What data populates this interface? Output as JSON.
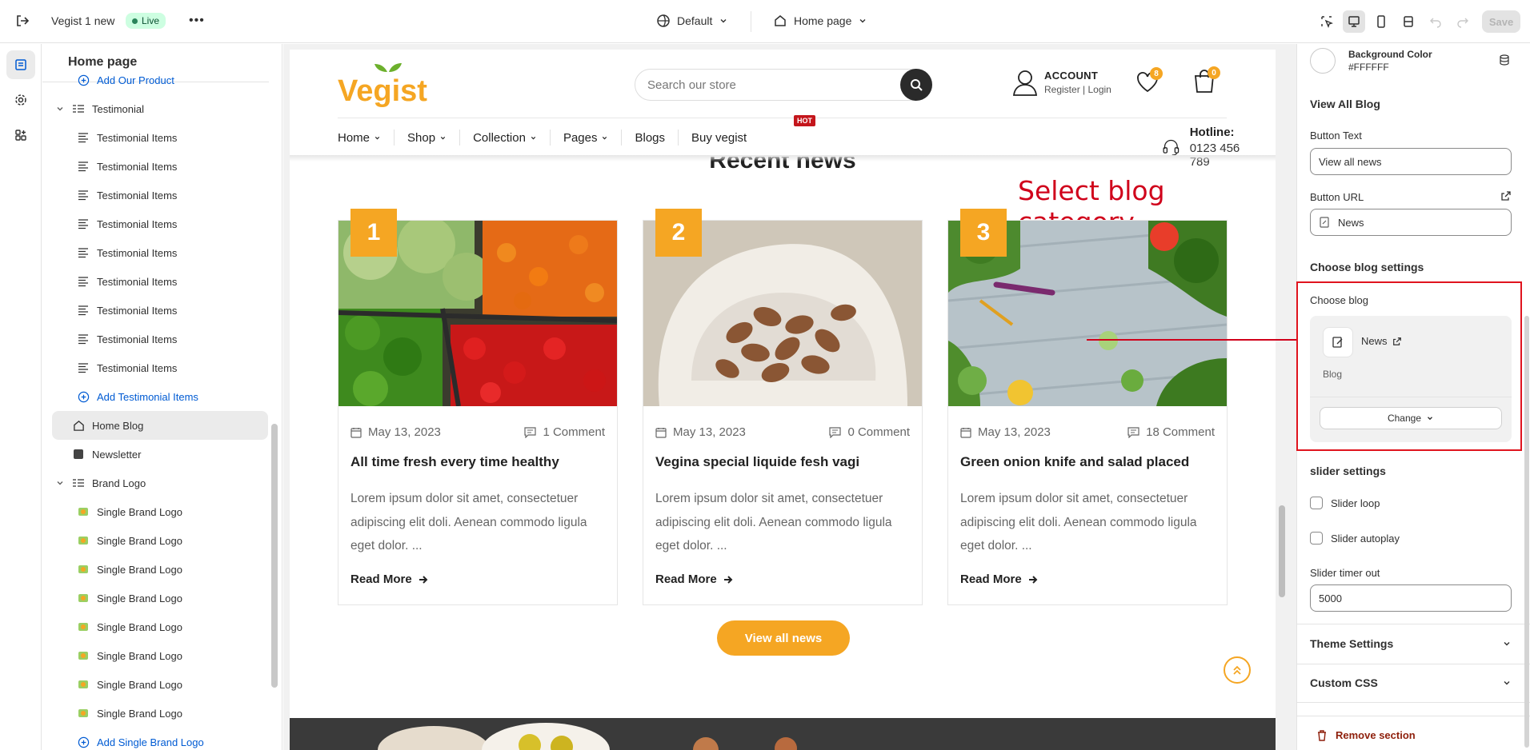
{
  "topbar": {
    "store_name": "Vegist 1 new",
    "status": "Live",
    "theme": "Default",
    "page": "Home page",
    "save": "Save"
  },
  "sidebar": {
    "title": "Home page",
    "items": [
      {
        "label": "Add Our Product",
        "kind": "add"
      },
      {
        "label": "Testimonial",
        "kind": "section"
      },
      {
        "label": "Testimonial Items"
      },
      {
        "label": "Testimonial Items"
      },
      {
        "label": "Testimonial Items"
      },
      {
        "label": "Testimonial Items"
      },
      {
        "label": "Testimonial Items"
      },
      {
        "label": "Testimonial Items"
      },
      {
        "label": "Testimonial Items"
      },
      {
        "label": "Testimonial Items"
      },
      {
        "label": "Testimonial Items"
      },
      {
        "label": "Add Testimonial Items",
        "kind": "add"
      },
      {
        "label": "Home Blog",
        "kind": "selected"
      },
      {
        "label": "Newsletter",
        "kind": "section"
      },
      {
        "label": "Brand Logo",
        "kind": "section"
      },
      {
        "label": "Single Brand Logo"
      },
      {
        "label": "Single Brand Logo"
      },
      {
        "label": "Single Brand Logo"
      },
      {
        "label": "Single Brand Logo"
      },
      {
        "label": "Single Brand Logo"
      },
      {
        "label": "Single Brand Logo"
      },
      {
        "label": "Single Brand Logo"
      },
      {
        "label": "Single Brand Logo"
      },
      {
        "label": "Add Single Brand Logo",
        "kind": "add"
      }
    ]
  },
  "store": {
    "logo": "Vegist",
    "search_placeholder": "Search our store",
    "account": {
      "title": "ACCOUNT",
      "register": "Register",
      "login": "Login"
    },
    "wishlist_count": "8",
    "cart_count": "0",
    "nav": [
      "Home",
      "Shop",
      "Collection",
      "Pages",
      "Blogs",
      "Buy vegist"
    ],
    "hot": "HOT",
    "hotline": {
      "label": "Hotline:",
      "number": "0123 456 789"
    },
    "section_title": "Recent news",
    "annotation": "Select blog category",
    "posts": [
      {
        "num": "1",
        "date": "May 13, 2023",
        "comments": "1 Comment",
        "title": "All time fresh every time healthy",
        "excerpt": "Lorem ipsum dolor sit amet, consectetuer adipiscing elit doli. Aenean commodo ligula eget dolor. ...",
        "read": "Read More"
      },
      {
        "num": "2",
        "date": "May 13, 2023",
        "comments": "0 Comment",
        "title": "Vegina special liquide fesh vagi",
        "excerpt": "Lorem ipsum dolor sit amet, consectetuer adipiscing elit doli. Aenean commodo ligula eget dolor. ...",
        "read": "Read More"
      },
      {
        "num": "3",
        "date": "May 13, 2023",
        "comments": "18 Comment",
        "title": "Green onion knife and salad placed",
        "excerpt": "Lorem ipsum dolor sit amet, consectetuer adipiscing elit doli. Aenean commodo ligula eget dolor. ...",
        "read": "Read More"
      }
    ],
    "view_all": "View all news",
    "colors": {
      "accent": "#f5a623",
      "green": "#6cb02c"
    }
  },
  "settings": {
    "bg_color_label": "Background Color",
    "bg_color_value": "#FFFFFF",
    "view_all_blog": "View All Blog",
    "button_text_label": "Button Text",
    "button_text_value": "View all news",
    "button_url_label": "Button URL",
    "button_url_value": "News",
    "choose_blog_settings": "Choose blog settings",
    "choose_blog_label": "Choose blog",
    "blog_name": "News",
    "blog_type": "Blog",
    "change": "Change",
    "slider_settings": "slider settings",
    "slider_loop": "Slider loop",
    "slider_autoplay": "Slider autoplay",
    "slider_timer_label": "Slider timer out",
    "slider_timer_value": "5000",
    "theme_settings": "Theme Settings",
    "custom_css": "Custom CSS",
    "remove_section": "Remove section"
  }
}
